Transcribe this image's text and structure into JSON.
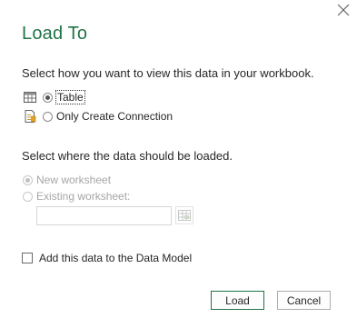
{
  "dialog": {
    "title": "Load To",
    "close_icon": "close-icon"
  },
  "view": {
    "label": "Select how you want to view this data in your workbook.",
    "options": [
      {
        "label": "Table",
        "icon": "table-icon",
        "checked": true
      },
      {
        "label": "Only Create Connection",
        "icon": "connection-icon",
        "checked": false
      }
    ]
  },
  "location": {
    "label": "Select where the data should be loaded.",
    "options": [
      {
        "label": "New worksheet",
        "checked": true,
        "disabled": true
      },
      {
        "label": "Existing worksheet:",
        "checked": false,
        "disabled": true
      }
    ],
    "existing_value": "",
    "range_icon": "range-picker-icon"
  },
  "data_model": {
    "label": "Add this data to the Data Model",
    "checked": false
  },
  "buttons": {
    "load": "Load",
    "cancel": "Cancel"
  },
  "colors": {
    "title": "#217346",
    "disabled_text": "#a6a6a6",
    "text": "#262626"
  }
}
